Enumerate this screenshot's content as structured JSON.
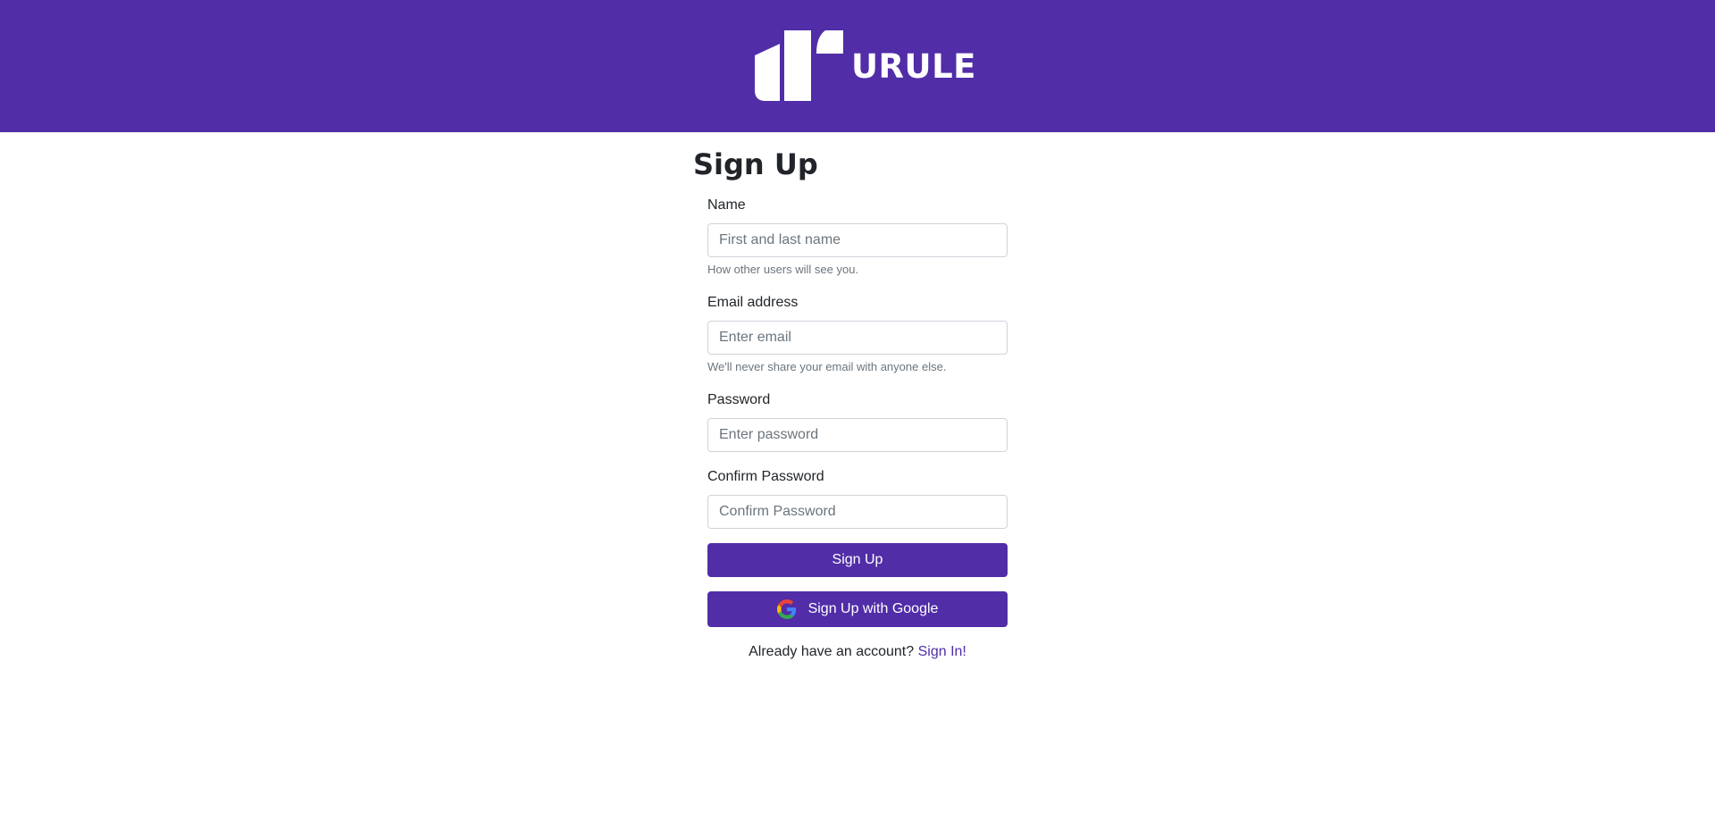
{
  "header": {
    "brand": "URULE",
    "bg_color": "#512da8",
    "logo_icon": "urule-logo-icon"
  },
  "form": {
    "title": "Sign Up",
    "name": {
      "label": "Name",
      "placeholder": "First and last name",
      "help": "How other users will see you."
    },
    "email": {
      "label": "Email address",
      "placeholder": "Enter email",
      "help": "We'll never share your email with anyone else."
    },
    "password": {
      "label": "Password",
      "placeholder": "Enter password"
    },
    "confirm_password": {
      "label": "Confirm Password",
      "placeholder": "Confirm Password"
    },
    "submit_label": "Sign Up",
    "google_label": "Sign Up with Google",
    "google_icon": "google-icon",
    "signin_prompt": "Already have an account?",
    "signin_link": "Sign In!"
  },
  "colors": {
    "accent": "#512da8",
    "text": "#212529",
    "muted": "#6c757d",
    "input_border": "#ced4da"
  }
}
